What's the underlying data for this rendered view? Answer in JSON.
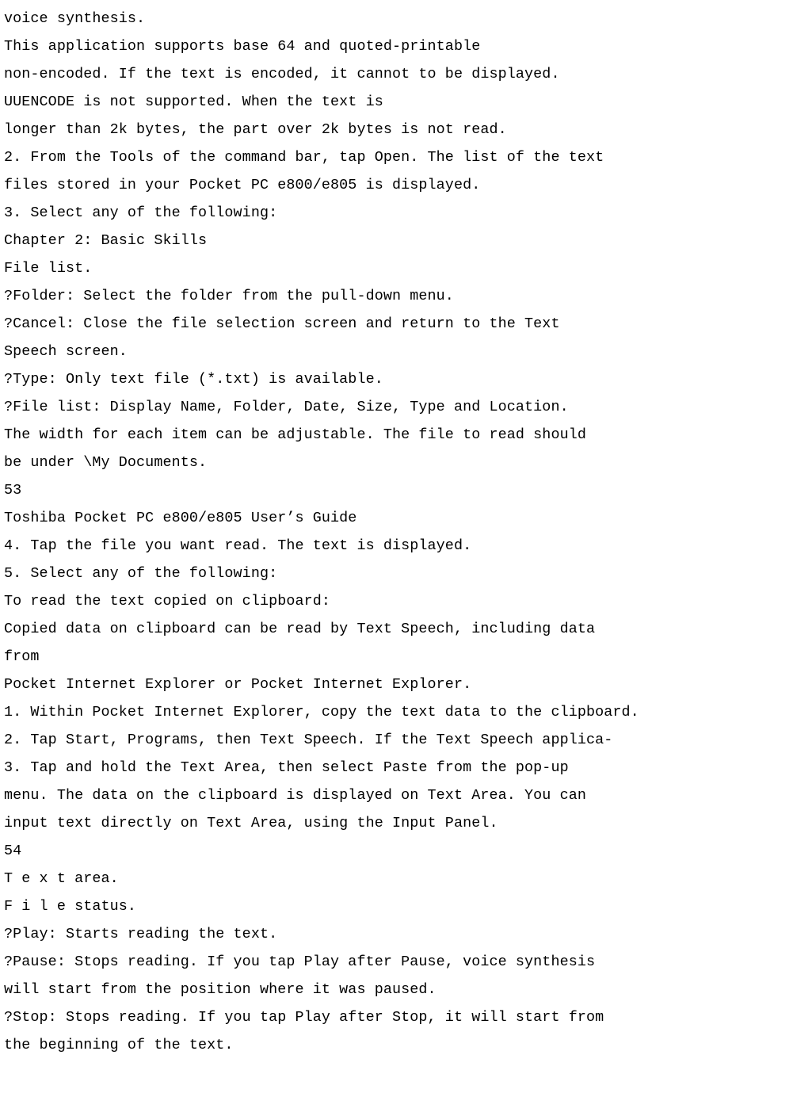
{
  "lines": [
    "voice synthesis.",
    "This application supports base 64 and quoted-printable",
    "non-encoded. If the text is encoded, it cannot to be displayed.",
    "UUENCODE is not supported. When the text is",
    "longer than 2k bytes, the part over 2k bytes is not read.",
    "2. From the Tools of the command bar, tap Open. The list of the text",
    "files stored in your Pocket PC e800/e805 is displayed.",
    "3. Select any of the following:",
    "Chapter 2: Basic Skills",
    "File list.",
    "?Folder: Select the folder from the pull-down menu.",
    "?Cancel: Close the file selection screen and return to the Text",
    "Speech screen.",
    "?Type: Only text file (*.txt) is available.",
    "?File list: Display Name, Folder, Date, Size, Type and Location.",
    "The width for each item can be adjustable. The file to read should",
    "be under \\My Documents.",
    "53",
    "Toshiba Pocket PC e800/e805 User’s Guide",
    "4. Tap the file you want read. The text is displayed.",
    "5. Select any of the following:",
    "To read the text copied on clipboard:",
    "Copied data on clipboard can be read by Text Speech, including data",
    "from",
    "Pocket Internet Explorer or Pocket Internet Explorer.",
    "1. Within Pocket Internet Explorer, copy the text data to the clipboard.",
    "2. Tap Start, Programs, then Text Speech. If the Text Speech applica-",
    "3. Tap and hold the Text Area, then select Paste from the pop-up",
    "menu. The data on the clipboard is displayed on Text Area. You can",
    "input text directly on Text Area, using the Input Panel.",
    "54",
    "T e x t area.",
    "F i l e status.",
    "?Play: Starts reading the text.",
    "?Pause: Stops reading. If you tap Play after Pause, voice synthesis",
    "will start from the position where it was paused.",
    "?Stop: Stops reading. If you tap Play after Stop, it will start from",
    "the beginning of the text."
  ]
}
